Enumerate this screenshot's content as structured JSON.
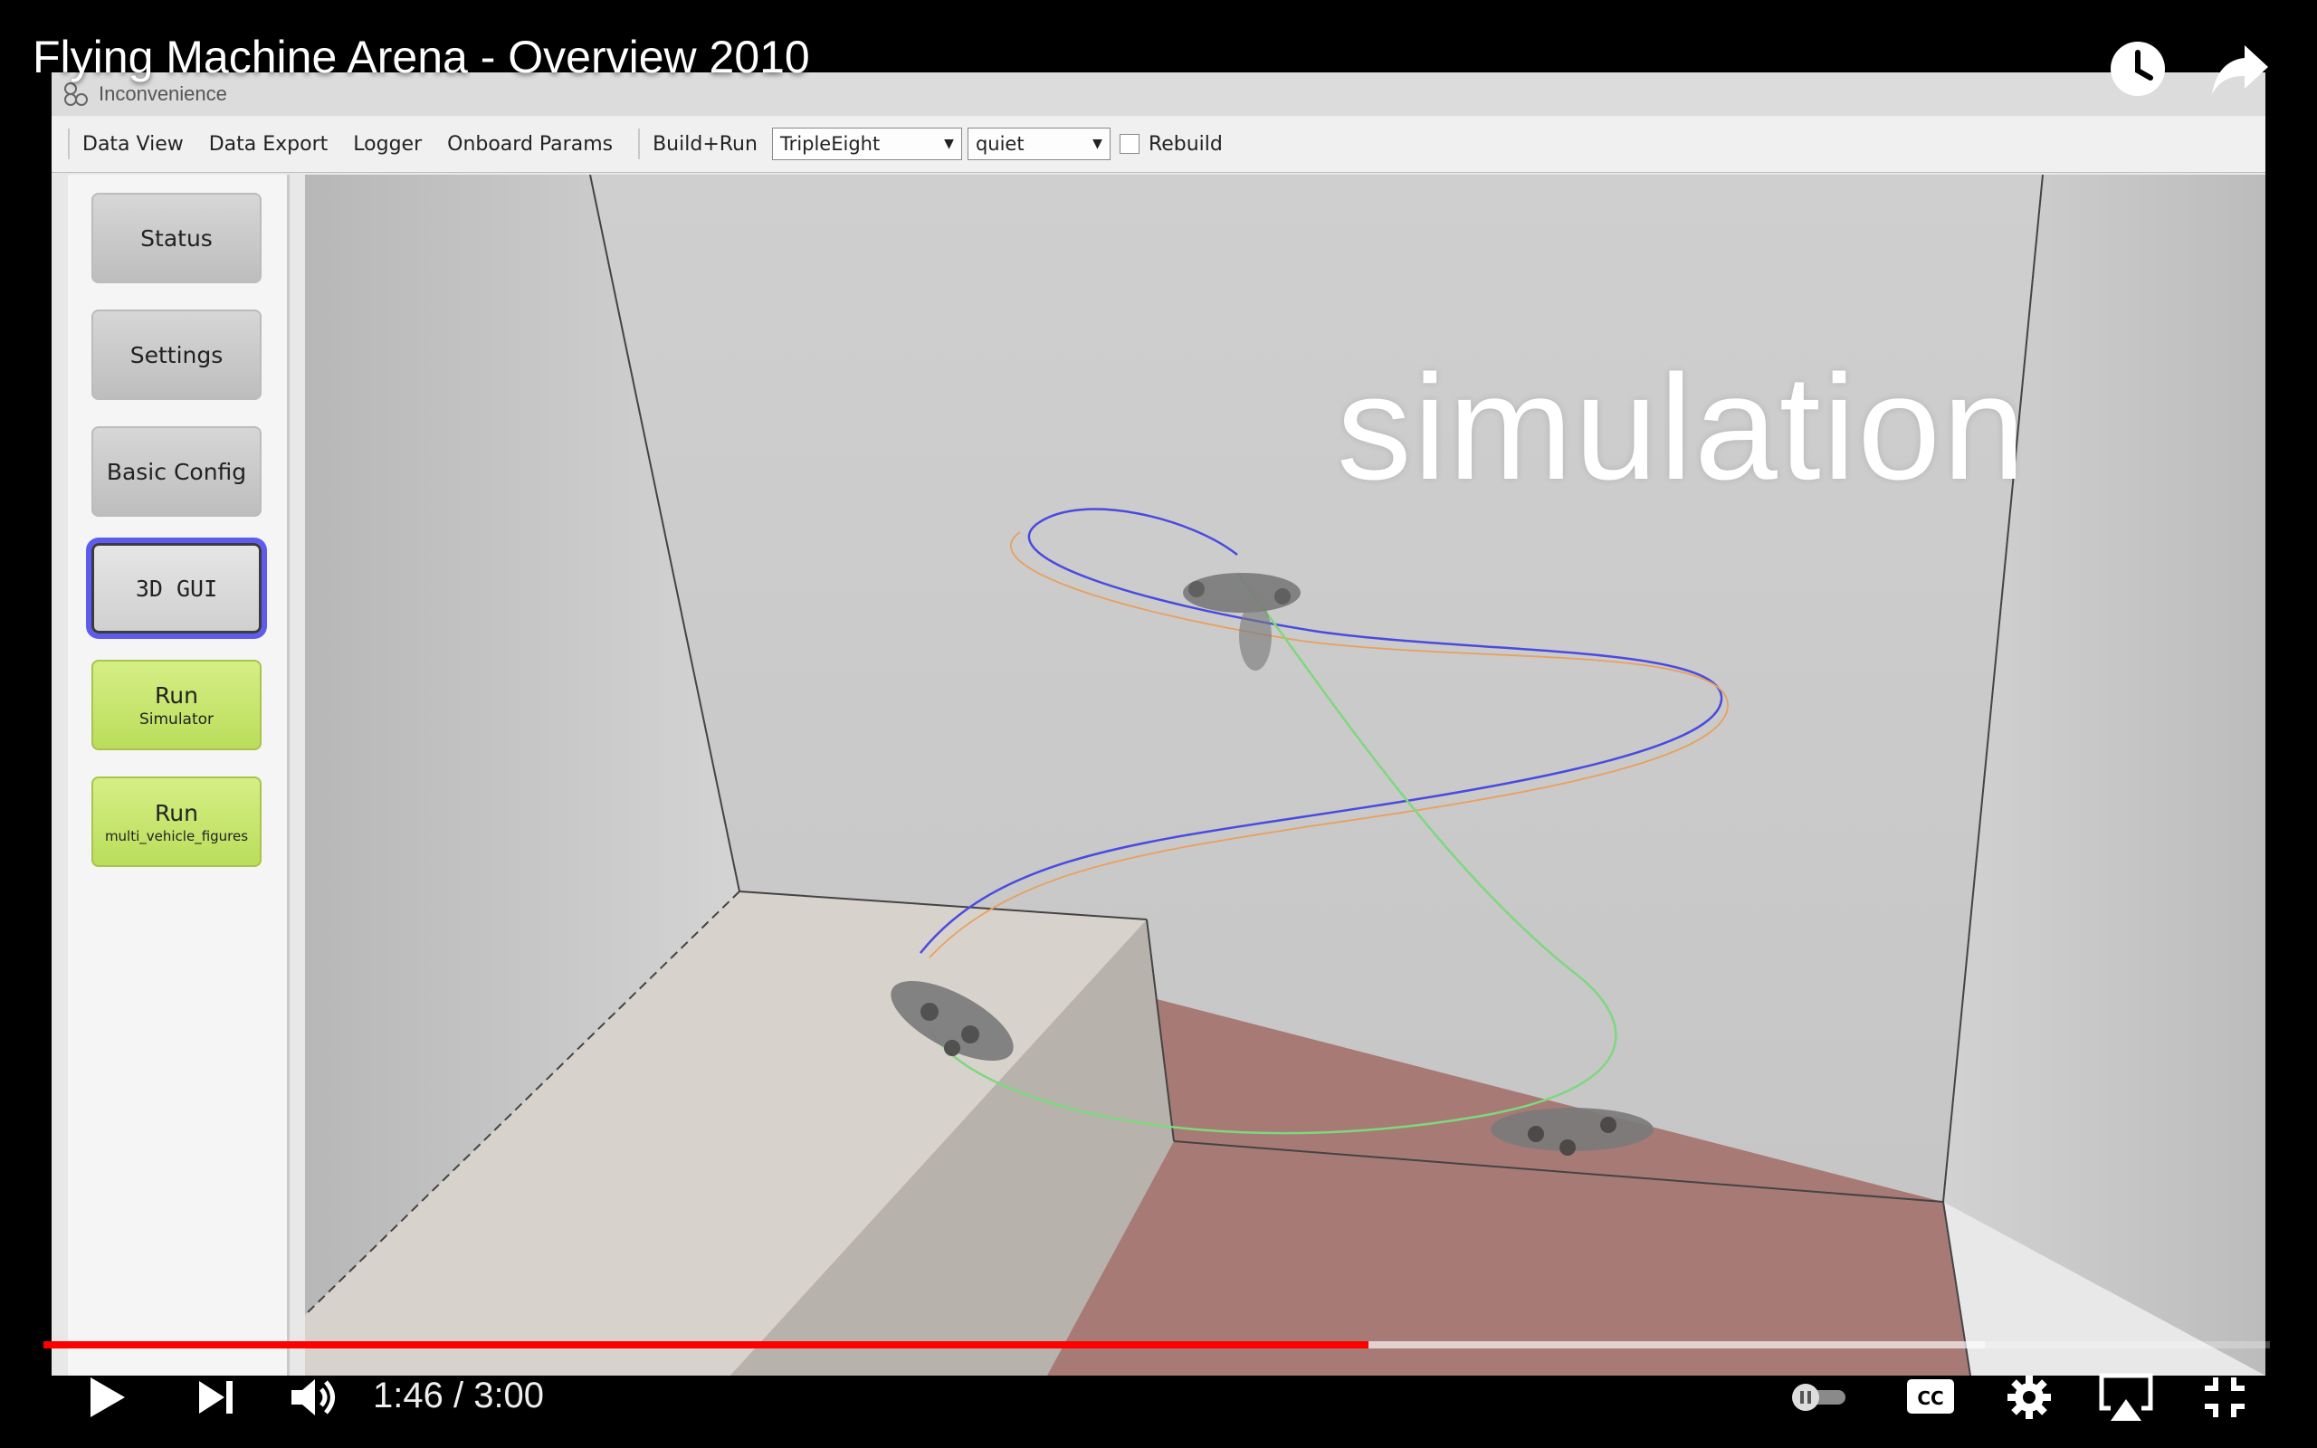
{
  "video": {
    "title": "Flying Machine Arena - Overview 2010",
    "time_display": "1:46 / 3:00",
    "progress_played": 0.595,
    "progress_buffered": 0.872
  },
  "app": {
    "window_title": "Inconvenience",
    "toolbar": {
      "items": [
        "Data View",
        "Data Export",
        "Logger",
        "Onboard Params",
        "Build+Run"
      ],
      "trajectory_select": "TripleEight",
      "verbosity_select": "quiet",
      "rebuild_label": "Rebuild"
    },
    "sidebar": {
      "status": "Status",
      "settings": "Settings",
      "basic_config": "Basic Config",
      "gui3d": "3D GUI",
      "run_sim_main": "Run",
      "run_sim_sub": "Simulator",
      "run_multi_main": "Run",
      "run_multi_sub": "multi_vehicle_figures"
    },
    "overlay_label": "simulation"
  },
  "colors": {
    "progress_red": "#ff0000",
    "active_outline": "#5e5cf0",
    "run_green": "#c5e86c",
    "trajectory_blue": "#4a4ae0",
    "trajectory_green": "#7ed87e",
    "trajectory_orange": "#e8a060",
    "floor_red": "#a77a76"
  },
  "icons": [
    "watch-later-icon",
    "share-icon",
    "play-icon",
    "next-icon",
    "volume-icon",
    "autoplay-toggle-icon",
    "captions-icon",
    "settings-icon",
    "airplay-icon",
    "exit-fullscreen-icon"
  ]
}
